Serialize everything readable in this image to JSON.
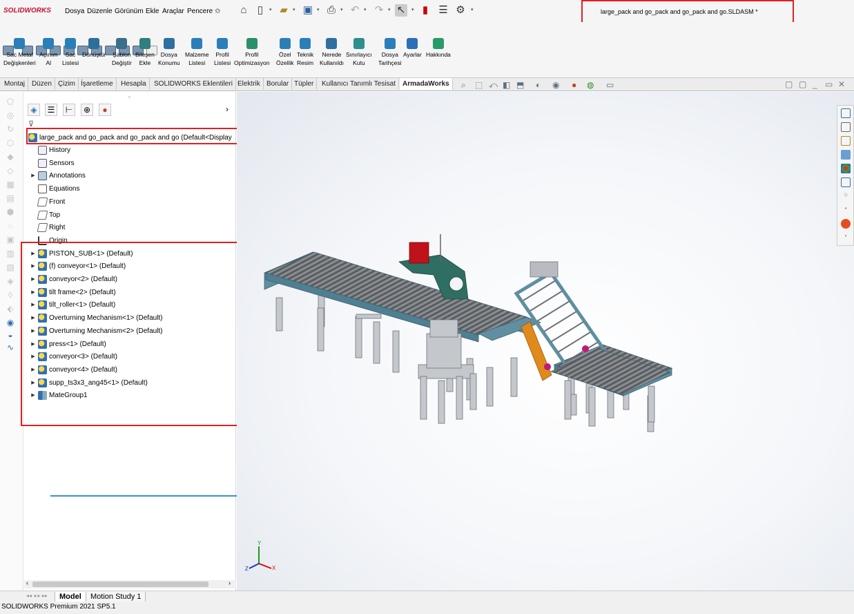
{
  "app": {
    "logo_text": "SOLIDWORKS",
    "document_title": "large_pack and go_pack and go_pack and go.SLDASM *",
    "status": "SOLIDWORKS Premium 2021 SP5.1"
  },
  "menu": [
    "Dosya",
    "Düzenle",
    "Görünüm",
    "Ekle",
    "Araçlar",
    "Pencere"
  ],
  "pin_icon": "✩",
  "quick_access_icons": [
    "home-icon",
    "new-doc-icon",
    "open-icon",
    "save-icon",
    "print-icon",
    "undo-icon",
    "redo-icon",
    "select-icon",
    "rebuild-icon",
    "file-properties-icon",
    "options-icon"
  ],
  "commandmanager": [
    {
      "label1": "Sac Metal",
      "label2": "Değişkenleri",
      "color": "#2b7fb8"
    },
    {
      "label1": "Açınım",
      "label2": "Al",
      "color": "#2b7fb8"
    },
    {
      "label1": "Sac",
      "label2": "Listesi",
      "color": "#2b7fb8"
    },
    {
      "label1": "Dönüştür",
      "label2": "",
      "color": "#2d6f9a"
    },
    {
      "label1": "Şablon",
      "label2": "Değiştir",
      "color": "#3a6f8c"
    },
    {
      "label1": "Bileşen",
      "label2": "Ekle",
      "color": "#2e7f7e"
    },
    {
      "label1": "Dosya",
      "label2": "Konumu",
      "color": "#2e6fa0"
    },
    {
      "label1": "Malzeme",
      "label2": "Listesi",
      "color": "#2b7fb8"
    },
    {
      "label1": "Profil",
      "label2": "Listesi",
      "color": "#2b7fb8"
    },
    {
      "label1": "Profil",
      "label2": "Optimizasyon",
      "color": "#2b8f6a"
    },
    {
      "label1": "Özel",
      "label2": "Özellik",
      "color": "#2b7fb8"
    },
    {
      "label1": "Teknik",
      "label2": "Resim",
      "color": "#2b7fb8"
    },
    {
      "label1": "Nerede",
      "label2": "Kullanıldı",
      "color": "#2e6fa0"
    },
    {
      "label1": "Sınırlayıcı",
      "label2": "Kutu",
      "color": "#2e8f8e"
    },
    {
      "label1": "Dosya",
      "label2": "Tarihçesi",
      "color": "#2b7fb8"
    },
    {
      "label1": "Ayarlar",
      "label2": "",
      "color": "#2b6fb8"
    },
    {
      "label1": "Hakkında",
      "label2": "",
      "color": "#2a9a6a"
    }
  ],
  "tabs": [
    "Montaj",
    "Düzen",
    "Çizim",
    "İşaretleme",
    "Hesapla",
    "SOLIDWORKS Eklentileri",
    "Elektrik",
    "Borular",
    "Tüpler",
    "Kullanıcı Tanımlı Tesisat",
    "ArmadaWorks"
  ],
  "active_tab": "ArmadaWorks",
  "tree": {
    "root": "large_pack and go_pack and go_pack and go  (Default<Display",
    "items": [
      {
        "label": "History",
        "icon": "history-icon",
        "expandable": false
      },
      {
        "label": "Sensors",
        "icon": "sensors-icon",
        "expandable": false
      },
      {
        "label": "Annotations",
        "icon": "annotations-icon",
        "expandable": true
      },
      {
        "label": "Equations",
        "icon": "equations-icon",
        "expandable": false
      },
      {
        "label": "Front",
        "icon": "plane-icon",
        "expandable": false
      },
      {
        "label": "Top",
        "icon": "plane-icon",
        "expandable": false
      },
      {
        "label": "Right",
        "icon": "plane-icon",
        "expandable": false
      },
      {
        "label": "Origin",
        "icon": "origin-icon",
        "expandable": false
      },
      {
        "label": "PISTON_SUB<1> (Default)",
        "icon": "subassembly-icon",
        "expandable": true
      },
      {
        "label": "(f) conveyor<1> (Default)",
        "icon": "subassembly-icon",
        "expandable": true
      },
      {
        "label": "conveyor<2> (Default)",
        "icon": "subassembly-icon",
        "expandable": true
      },
      {
        "label": "tilt frame<2> (Default)",
        "icon": "subassembly-icon",
        "expandable": true
      },
      {
        "label": "tilt_roller<1> (Default)",
        "icon": "subassembly-icon",
        "expandable": true
      },
      {
        "label": "Overturning Mechanism<1> (Default)",
        "icon": "subassembly-icon",
        "expandable": true
      },
      {
        "label": "Overturning Mechanism<2> (Default)",
        "icon": "subassembly-icon",
        "expandable": true
      },
      {
        "label": "press<1> (Default)",
        "icon": "subassembly-icon",
        "expandable": true
      },
      {
        "label": "conveyor<3> (Default)",
        "icon": "subassembly-icon",
        "expandable": true
      },
      {
        "label": "conveyor<4> (Default)",
        "icon": "subassembly-icon",
        "expandable": true
      },
      {
        "label": "supp_ts3x3_ang45<1> (Default)",
        "icon": "subassembly-icon",
        "expandable": true
      },
      {
        "label": "MateGroup1",
        "icon": "mates-icon",
        "expandable": true
      }
    ]
  },
  "bottom_tabs": [
    "Model",
    "Motion Study 1"
  ],
  "triad": {
    "x": "X",
    "y": "Y",
    "z": "Z"
  },
  "colors": {
    "highlight_box": "#e02020",
    "frame": "#5f8fa0",
    "roller": "#4a4a4a",
    "leg": "#bfc3c7",
    "press": "#2f6e62",
    "motor": "#c0121a"
  }
}
